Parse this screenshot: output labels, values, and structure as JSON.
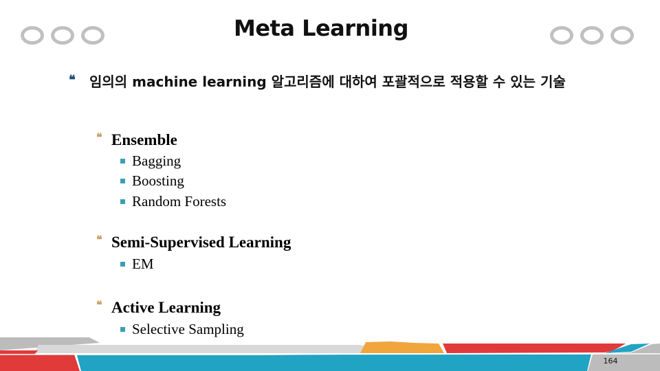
{
  "slide": {
    "title": "Meta Learning",
    "page_number": "164",
    "colors": {
      "ring": "#c0c0c0",
      "level1_bullet": "#1f4f78",
      "level2_bullet": "#c9a36a",
      "level3_bullet": "#3aa0b5",
      "band_red": "#e03a3a",
      "band_teal": "#21a3c4",
      "band_orange": "#f0a63c",
      "band_gray": "#bcbcbc",
      "band_light_gray": "#d9d9d9"
    },
    "decorations": {
      "left_rings_icon": "three-rings-icon",
      "right_rings_icon": "three-rings-icon",
      "level1_bullet_icon": "quote-bullet-icon",
      "level2_bullet_icon": "quote-bullet-icon",
      "level3_bullet_icon": "square-bullet-icon"
    },
    "body": {
      "intro": "임의의 machine learning 알고리즘에 대하여 포괄적으로 적용할 수 있는 기술",
      "sections": [
        {
          "heading": "Ensemble",
          "items": [
            "Bagging",
            "Boosting",
            "Random Forests"
          ]
        },
        {
          "heading": "Semi-Supervised Learning",
          "items": [
            "EM"
          ]
        },
        {
          "heading": "Active Learning",
          "items": [
            "Selective Sampling"
          ]
        }
      ]
    }
  }
}
